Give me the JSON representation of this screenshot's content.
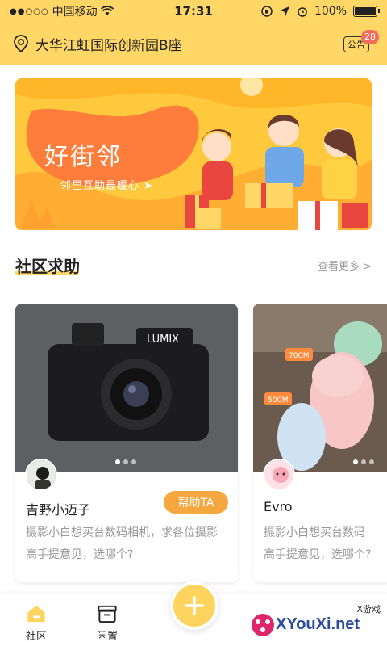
{
  "status_bar": {
    "carrier": "中国移动",
    "time": "17:31",
    "battery": "100%",
    "battery_level": 1.0
  },
  "header": {
    "address": "大华江虹国际创新园B座",
    "notice_label": "公告",
    "notice_count": "28"
  },
  "banner": {
    "title": "好街邻",
    "subtitle": "邻里互助最暖心 ➤"
  },
  "section": {
    "title": "社区求助",
    "more": "查看更多 >"
  },
  "cards": [
    {
      "user": "吉野小迈子",
      "action": "帮助TA",
      "desc_line1": "摄影小白想买台数码相机，求各位摄影",
      "desc_line2": "高手提意见，选哪个?",
      "image_label": "LUMIX"
    },
    {
      "user": "Evro",
      "desc_line1": "摄影小白想买台数码",
      "desc_line2": "高手提意见，选哪个?",
      "tag1": "70CM",
      "tag2": "50CM"
    }
  ],
  "tabs": [
    {
      "label": "社区",
      "icon": "home-icon"
    },
    {
      "label": "闲置",
      "icon": "box-icon"
    }
  ],
  "watermark": {
    "brand": "XYouXi.net",
    "small": "X游戏"
  },
  "colors": {
    "accent": "#ffd766",
    "button": "#f5a740",
    "badge": "#f36b5a"
  }
}
